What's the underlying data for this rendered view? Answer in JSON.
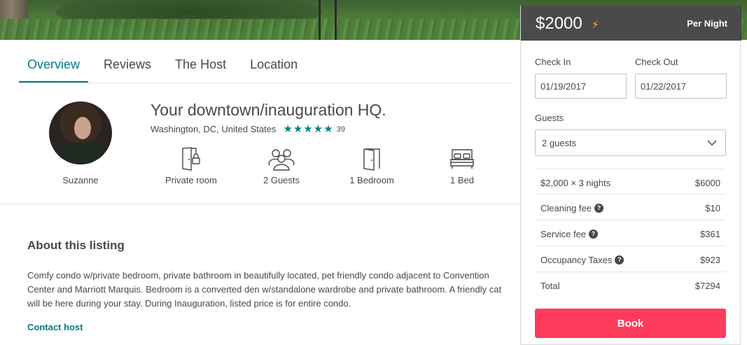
{
  "tabs": [
    {
      "label": "Overview"
    },
    {
      "label": "Reviews"
    },
    {
      "label": "The Host"
    },
    {
      "label": "Location"
    }
  ],
  "host": {
    "name": "Suzanne"
  },
  "listing": {
    "title": "Your downtown/inauguration HQ.",
    "location": "Washington, DC, United States",
    "rating_stars": 5,
    "review_count": "39",
    "amenities": [
      {
        "icon": "door-lock-icon",
        "label": "Private room"
      },
      {
        "icon": "guests-icon",
        "label": "2 Guests"
      },
      {
        "icon": "door-icon",
        "label": "1 Bedroom"
      },
      {
        "icon": "bed-icon",
        "label": "1 Bed"
      }
    ]
  },
  "about": {
    "title": "About this listing",
    "body": "Comfy condo w/private bedroom, private bathroom in beautifully located, pet friendly condo adjacent to Convention Center and Marriott Marquis. Bedroom is a converted den w/standalone wardrobe and private bathroom. A friendly cat will be here during your stay. During Inauguration, listed price is for entire condo.",
    "contact_label": "Contact host"
  },
  "booking": {
    "price": "$2000",
    "per_night": "Per Night",
    "check_in_label": "Check In",
    "check_in_value": "01/19/2017",
    "check_out_label": "Check Out",
    "check_out_value": "01/22/2017",
    "guests_label": "Guests",
    "guests_value": "2 guests",
    "rows": [
      {
        "label": "$2,000 × 3 nights",
        "value": "$6000",
        "help": false
      },
      {
        "label": "Cleaning fee",
        "value": "$10",
        "help": true
      },
      {
        "label": "Service fee",
        "value": "$361",
        "help": true
      },
      {
        "label": "Occupancy Taxes",
        "value": "$923",
        "help": true
      },
      {
        "label": "Total",
        "value": "$7294",
        "help": false
      }
    ],
    "book_label": "Book"
  },
  "colors": {
    "accent": "#007a87",
    "star": "#00848a",
    "book": "#ff3b5c",
    "bolt": "#ffb400"
  }
}
